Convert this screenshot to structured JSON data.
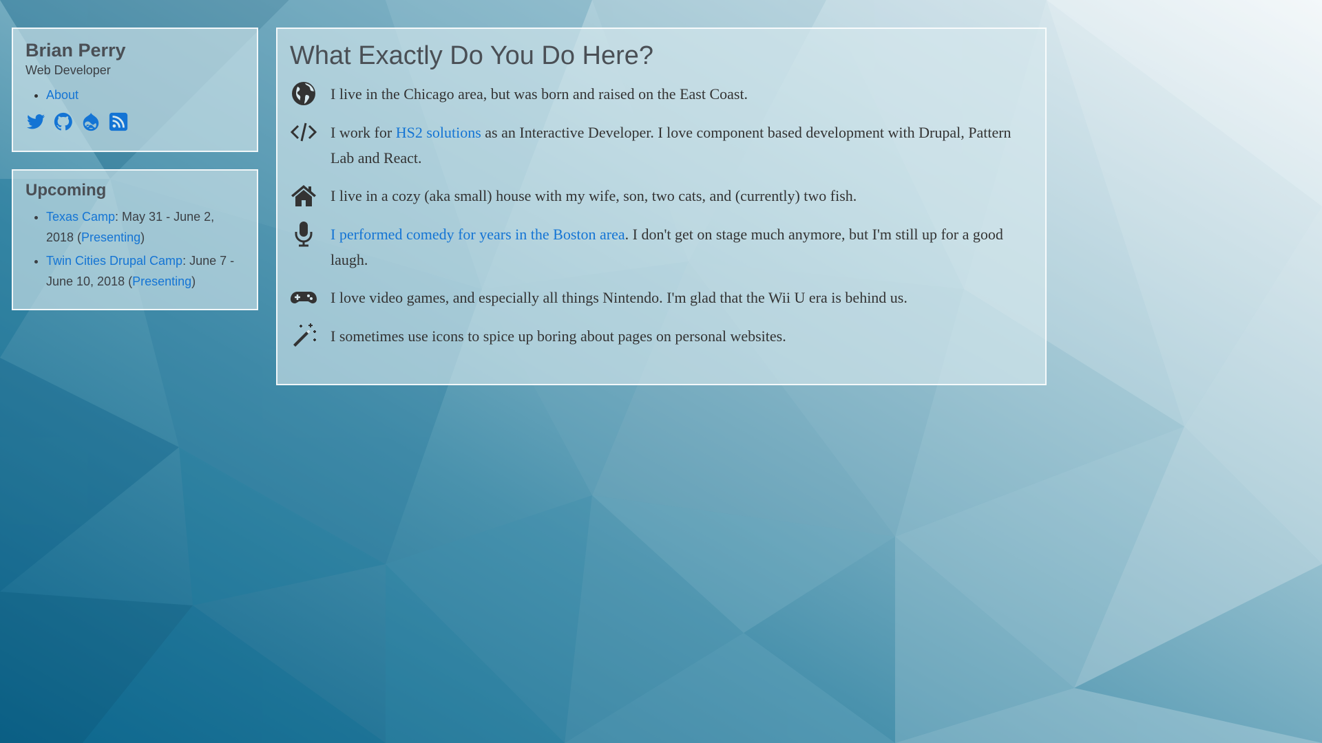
{
  "site": {
    "name": "Brian Perry",
    "tagline": "Web Developer",
    "nav": [
      {
        "label": "About"
      }
    ],
    "social": [
      {
        "icon": "twitter-icon"
      },
      {
        "icon": "github-icon"
      },
      {
        "icon": "drupal-icon"
      },
      {
        "icon": "rss-icon"
      }
    ]
  },
  "upcoming": {
    "title": "Upcoming",
    "events": [
      {
        "name": "Texas Camp",
        "dates": ": May 31 - June 2, 2018 (",
        "role": "Presenting",
        "close": ")"
      },
      {
        "name": "Twin Cities Drupal Camp",
        "dates": ": June 7 - June 10, 2018 (",
        "role": "Presenting",
        "close": ")"
      }
    ]
  },
  "main": {
    "title": "What Exactly Do You Do Here?",
    "facts": [
      {
        "icon": "globe-icon",
        "text": "I live in the Chicago area, but was born and raised on the East Coast."
      },
      {
        "icon": "code-icon",
        "before": "I work for ",
        "link": "HS2 solutions",
        "after": " as an Interactive Developer. I love component based development with Drupal, Pattern Lab and React."
      },
      {
        "icon": "home-icon",
        "text": "I live in a cozy (aka small) house with my wife, son, two cats, and (currently) two fish."
      },
      {
        "icon": "microphone-icon",
        "link": "I performed comedy for years in the Boston area",
        "after": ". I don't get on stage much anymore, but I'm still up for a good laugh."
      },
      {
        "icon": "gamepad-icon",
        "text": "I love video games, and especially all things Nintendo. I'm glad that the Wii U era is behind us."
      },
      {
        "icon": "magic-wand-icon",
        "text": "I sometimes use icons to spice up boring about pages on personal websites."
      }
    ]
  },
  "colors": {
    "link": "#1474d4",
    "text": "#333333",
    "bg_dark": "#0d6a8f",
    "bg_light": "#f2f6f8"
  }
}
